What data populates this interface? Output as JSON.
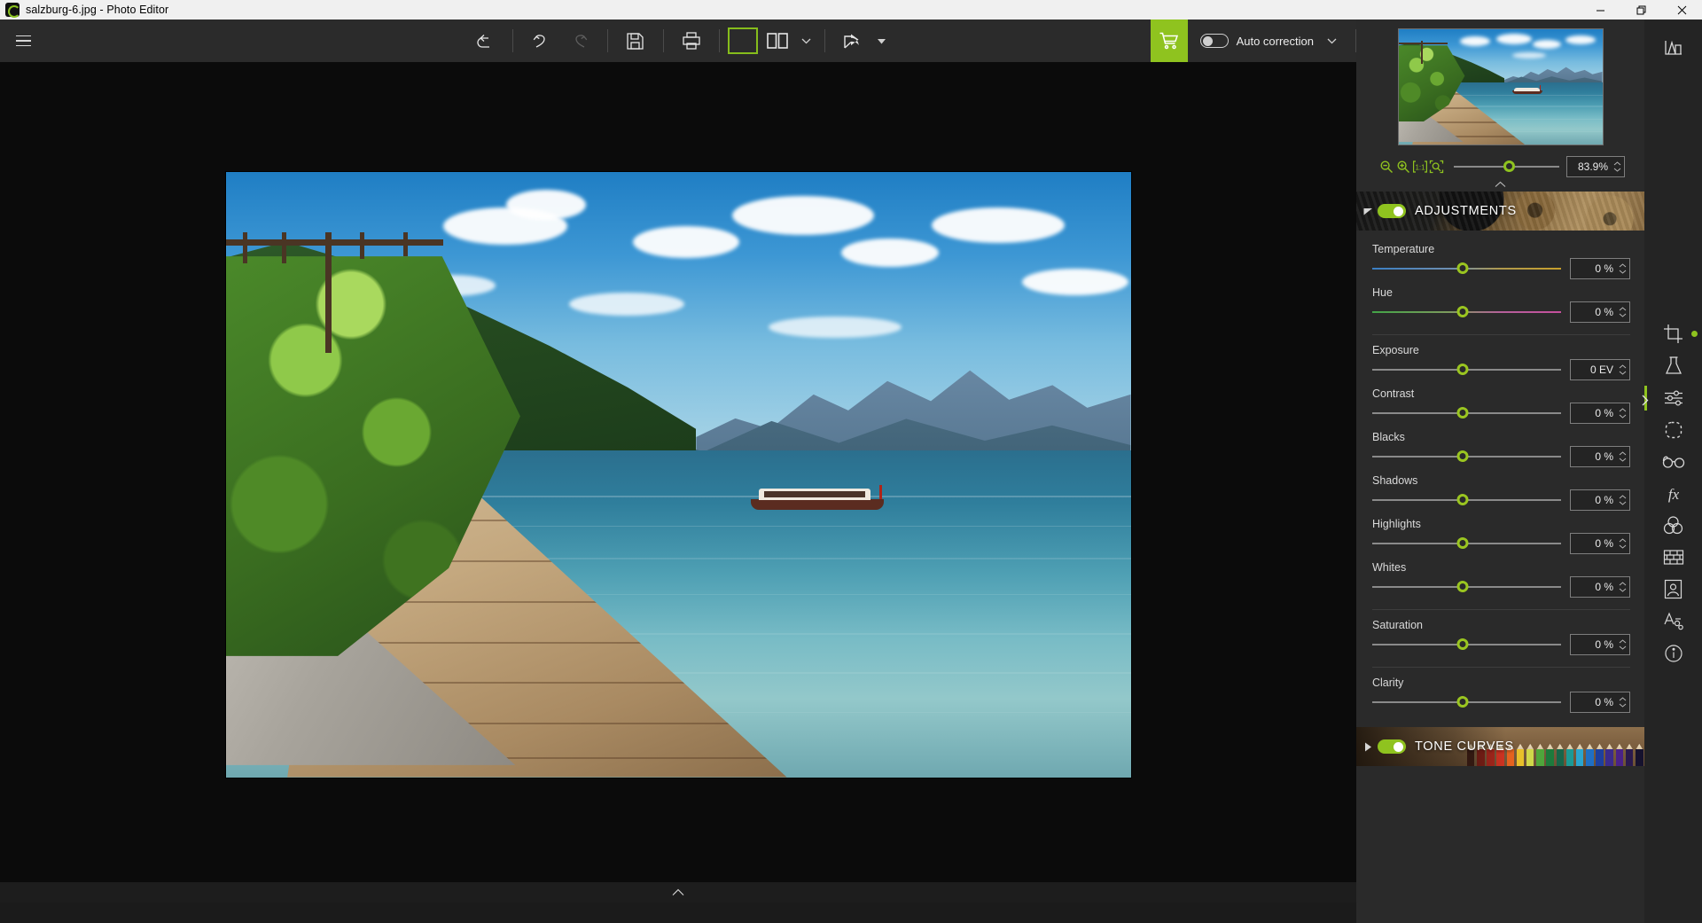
{
  "window": {
    "title": "salzburg-6.jpg - Photo Editor",
    "app_icon": "app-logo-icon",
    "minimize": "—",
    "restore": "❐",
    "close": "✕"
  },
  "toolbar": {
    "menu": "hamburger-menu",
    "buttons": [
      {
        "name": "revert-button",
        "icon": "revert-arrow-icon",
        "enabled": true
      },
      {
        "name": "undo-button",
        "icon": "undo-icon",
        "enabled": true
      },
      {
        "name": "redo-button",
        "icon": "redo-icon",
        "enabled": false
      },
      {
        "name": "save-button",
        "icon": "floppy-disk-icon",
        "enabled": true
      },
      {
        "name": "print-button",
        "icon": "printer-icon",
        "enabled": true
      }
    ],
    "view_single": "single-view-icon",
    "view_split": "split-view-icon",
    "view_dropdown": "chevron-down-icon",
    "share": "share-icon",
    "share_dropdown": "chevron-down-icon",
    "cart": "shopping-cart-icon",
    "auto_correction_label": "Auto correction",
    "auto_correction_on": false,
    "auto_correction_dropdown": "chevron-down-icon"
  },
  "canvas": {
    "image_name": "salzburg-6.jpg",
    "collapse_handle": "chevron-up-icon"
  },
  "preview": {
    "thumbnail_name": "image-thumbnail",
    "panel_collapse": "chevron-up-icon"
  },
  "zoom": {
    "zoom_out_icon": "zoom-out-icon",
    "zoom_in_icon": "zoom-in-icon",
    "actual_size_icon": "actual-size-1-to-1-icon",
    "fit_window_icon": "fit-to-window-icon",
    "level": "83.9%",
    "slider_position_pct": 47
  },
  "sections": [
    {
      "id": "adjustments",
      "label": "ADJUSTMENTS",
      "expanded": true,
      "toggle_on": true,
      "triangle": "triangle-down-icon",
      "background": "gears-photo"
    },
    {
      "id": "tone_curves",
      "label": "TONE CURVES",
      "expanded": false,
      "toggle_on": true,
      "triangle": "triangle-right-icon",
      "background": "colored-pencils-photo"
    }
  ],
  "adjustments": {
    "groups": [
      {
        "name": "white-balance-group",
        "sliders": [
          {
            "label": "Temperature",
            "value": "0 %",
            "track": "temp",
            "position_pct": 48
          },
          {
            "label": "Hue",
            "value": "0 %",
            "track": "hue",
            "position_pct": 48
          }
        ]
      },
      {
        "name": "tone-group",
        "sliders": [
          {
            "label": "Exposure",
            "value": "0 EV",
            "track": "plain",
            "position_pct": 48
          },
          {
            "label": "Contrast",
            "value": "0 %",
            "track": "plain",
            "position_pct": 48
          },
          {
            "label": "Blacks",
            "value": "0 %",
            "track": "plain",
            "position_pct": 48
          },
          {
            "label": "Shadows",
            "value": "0 %",
            "track": "plain",
            "position_pct": 49
          },
          {
            "label": "Highlights",
            "value": "0 %",
            "track": "plain",
            "position_pct": 48
          },
          {
            "label": "Whites",
            "value": "0 %",
            "track": "plain",
            "position_pct": 48
          }
        ]
      },
      {
        "name": "color-group",
        "sliders": [
          {
            "label": "Saturation",
            "value": "0 %",
            "track": "plain",
            "position_pct": 48
          }
        ]
      },
      {
        "name": "detail-group",
        "sliders": [
          {
            "label": "Clarity",
            "value": "0 %",
            "track": "plain",
            "position_pct": 48
          }
        ]
      }
    ]
  },
  "tool_rail": {
    "top": [
      {
        "name": "histogram-tool",
        "icon": "histogram-icon",
        "active": false
      }
    ],
    "tools": [
      {
        "name": "crop-tool",
        "icon": "crop-icon",
        "active": false,
        "dot": true
      },
      {
        "name": "presets-tool",
        "icon": "flask-icon",
        "active": false
      },
      {
        "name": "adjustments-tool",
        "icon": "sliders-icon",
        "active": true
      },
      {
        "name": "selection-tool",
        "icon": "dashed-circle-icon",
        "active": false
      },
      {
        "name": "retouch-tool",
        "icon": "glasses-icon",
        "active": false
      },
      {
        "name": "effects-tool",
        "icon": "fx-icon",
        "active": false
      },
      {
        "name": "color-mix-tool",
        "icon": "color-circles-icon",
        "active": false
      },
      {
        "name": "texture-tool",
        "icon": "brick-grid-icon",
        "active": false
      },
      {
        "name": "frame-tool",
        "icon": "portrait-frame-icon",
        "active": false
      },
      {
        "name": "text-tool",
        "icon": "text-tool-icon",
        "active": false
      },
      {
        "name": "info-tool",
        "icon": "info-circle-icon",
        "active": false
      }
    ],
    "expand_arrow": "chevron-right-icon"
  },
  "colors": {
    "accent_green": "#8fc31f",
    "panel_bg": "#2a2a2a",
    "toolbar_bg": "#2b2b2b",
    "canvas_bg": "#0b0b0b",
    "titlebar_bg": "#f0f0f0"
  }
}
